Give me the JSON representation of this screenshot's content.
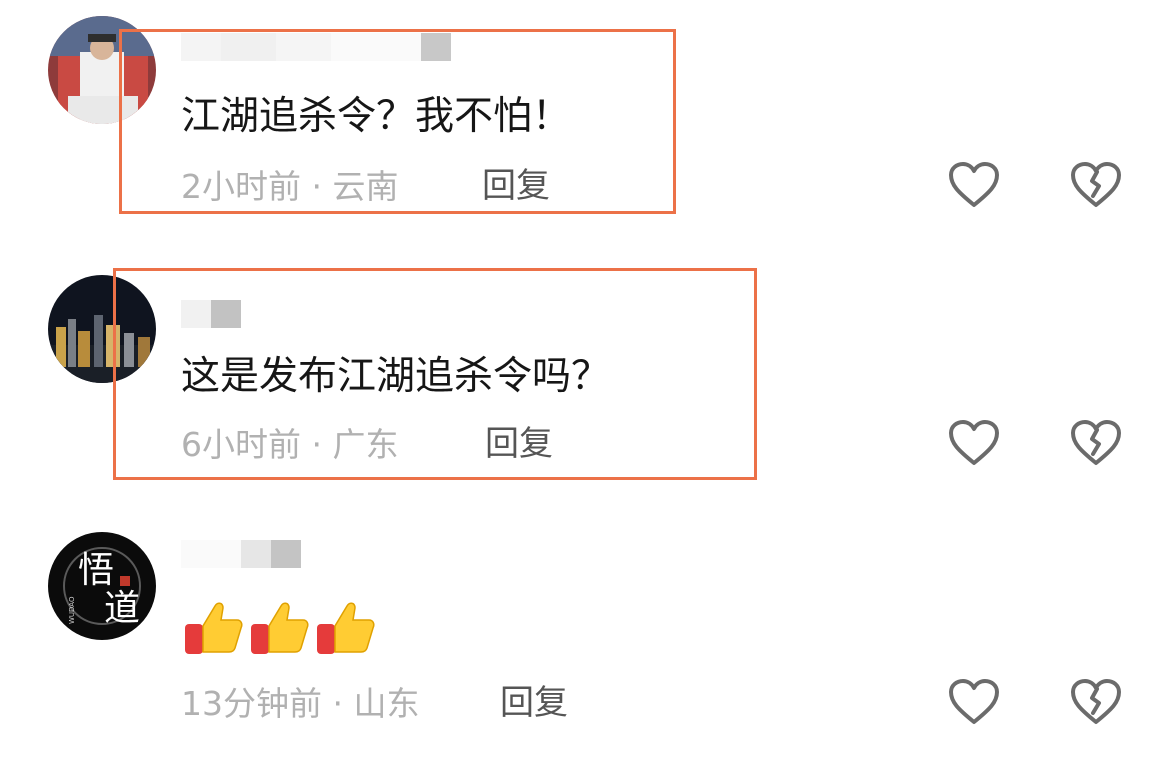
{
  "comments": [
    {
      "text": "江湖追杀令？我不怕！",
      "time": "2小时前",
      "separator": " · ",
      "location": "云南",
      "reply_label": "回复"
    },
    {
      "text": "这是发布江湖追杀令吗？",
      "time": "6小时前",
      "separator": " · ",
      "location": "广东",
      "reply_label": "回复"
    },
    {
      "text": "",
      "emoji": [
        "thumbs-up",
        "thumbs-up",
        "thumbs-up"
      ],
      "time": "13分钟前",
      "separator": " · ",
      "location": "山东",
      "reply_label": "回复",
      "avatar_text": [
        "悟",
        "道"
      ],
      "avatar_subtext": "WUDAO"
    }
  ],
  "icons": {
    "like": "heart-outline-icon",
    "dislike": "broken-heart-icon"
  },
  "colors": {
    "highlight_border": "#ec7148",
    "meta_text": "#b1b1b1",
    "icon_stroke": "#6b6b6b"
  }
}
